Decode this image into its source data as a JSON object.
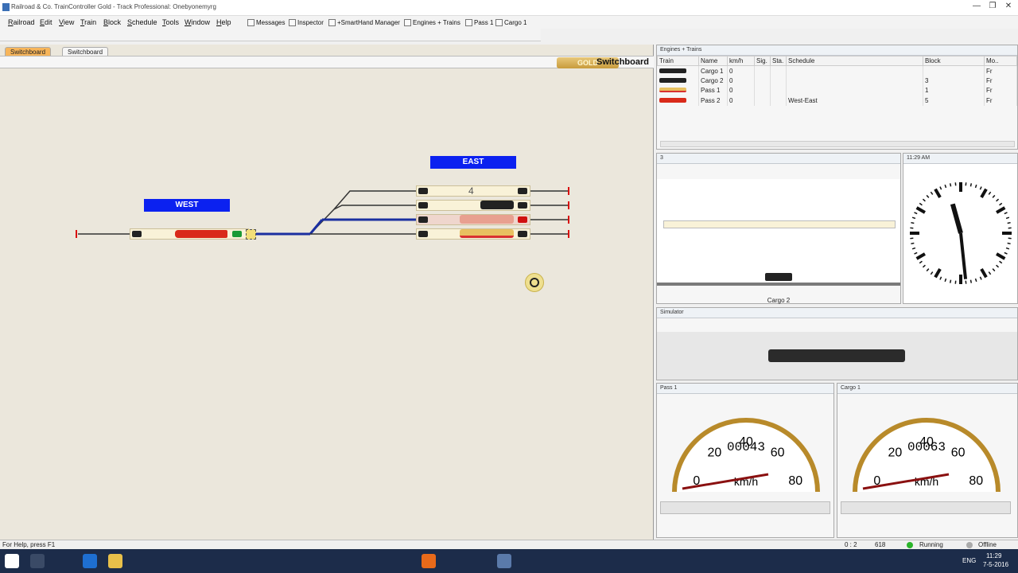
{
  "window": {
    "title": "Railroad & Co. TrainController Gold - Track Professional: Onebyonemyrg",
    "controls": [
      "—",
      "❐",
      "✕"
    ]
  },
  "menu": {
    "items": [
      "Railroad",
      "Edit",
      "View",
      "Train",
      "Block",
      "Schedule",
      "Tools",
      "Window",
      "Help"
    ],
    "tools": [
      "Messages",
      "Inspector",
      "+SmartHand Manager",
      "Engines + Trains",
      "Pass 1",
      "Cargo 1"
    ]
  },
  "tabs": [
    "Switchboard",
    "Switchboard"
  ],
  "switchboard": {
    "title": "Switchboard",
    "gold_badge": "GOLD",
    "stations": [
      "WEST",
      "EAST"
    ],
    "block_number": "4"
  },
  "trains_panel": {
    "title": "Engines + Trains",
    "columns": [
      "Train",
      "Name",
      "km/h",
      "Sig.",
      "Sta.",
      "Schedule",
      "Block",
      "Mo.."
    ],
    "rows": [
      {
        "name": "Cargo 1",
        "speed": "0",
        "schedule": "",
        "block": "",
        "type": "Fr"
      },
      {
        "name": "Cargo 2",
        "speed": "0",
        "schedule": "",
        "block": "3",
        "type": "Fr"
      },
      {
        "name": "Pass 1",
        "speed": "0",
        "schedule": "",
        "block": "1",
        "type": "Fr"
      },
      {
        "name": "Pass 2",
        "speed": "0",
        "schedule": "West-East",
        "block": "5",
        "type": "Fr"
      }
    ]
  },
  "block_panel": {
    "title": "3",
    "train_label": "Cargo 2"
  },
  "clock": {
    "title": "11:29 AM",
    "hour": 11,
    "minute": 29
  },
  "simulator": {
    "title": "Simulator"
  },
  "cabs": [
    {
      "title": "Pass 1",
      "odometer": "00043",
      "ticks": [
        "0",
        "20",
        "40",
        "60",
        "80"
      ],
      "unit": "km/h"
    },
    {
      "title": "Cargo 1",
      "odometer": "00063",
      "ticks": [
        "0",
        "20",
        "40",
        "60",
        "80"
      ],
      "unit": "km/h"
    }
  ],
  "status": {
    "help": "For Help, press F1",
    "coords": "0 : 2",
    "zoom": "618",
    "running": "Running",
    "offline": "Offline"
  },
  "taskbar": {
    "time": "11:29",
    "date": "7-5-2016",
    "lang": "ENG"
  },
  "colors": {
    "accent_blue": "#0b21f0",
    "track_blue": "#1b2fa0",
    "red_train": "#d92a1a"
  }
}
